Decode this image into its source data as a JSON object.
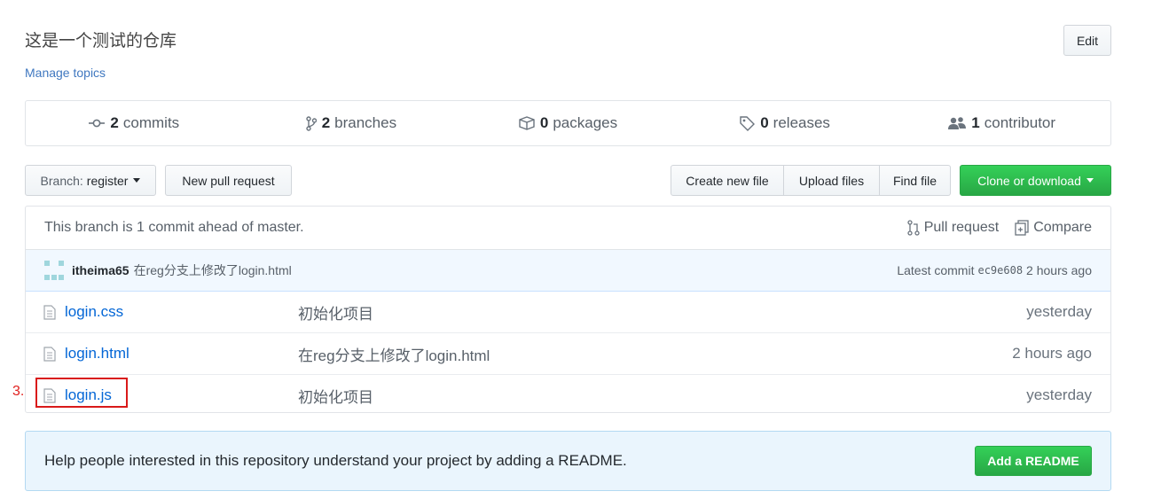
{
  "repo": {
    "description": "这是一个测试的仓库",
    "manage_topics": "Manage topics",
    "edit_label": "Edit"
  },
  "numbers": [
    {
      "icon": "commit-icon",
      "count": "2",
      "label": "commits"
    },
    {
      "icon": "branch-icon",
      "count": "2",
      "label": "branches"
    },
    {
      "icon": "package-icon",
      "count": "0",
      "label": "packages"
    },
    {
      "icon": "tag-icon",
      "count": "0",
      "label": "releases"
    },
    {
      "icon": "people-icon",
      "count": "1",
      "label": "contributor"
    }
  ],
  "toolbar": {
    "branch_prefix": "Branch:",
    "branch_name": "register",
    "new_pull_request": "New pull request",
    "create_new_file": "Create new file",
    "upload_files": "Upload files",
    "find_file": "Find file",
    "clone_or_download": "Clone or download"
  },
  "branch_info": {
    "ahead_text": "This branch is 1 commit ahead of master.",
    "pull_request": "Pull request",
    "compare": "Compare"
  },
  "commit": {
    "author": "itheima65",
    "message": "在reg分支上修改了login.html",
    "latest_label": "Latest commit",
    "sha": "ec9e608",
    "age": "2 hours ago"
  },
  "files": [
    {
      "name": "login.css",
      "message": "初始化项目",
      "age": "yesterday"
    },
    {
      "name": "login.html",
      "message": "在reg分支上修改了login.html",
      "age": "2 hours ago"
    },
    {
      "name": "login.js",
      "message": "初始化项目",
      "age": "yesterday"
    }
  ],
  "annotation": {
    "label": "3.",
    "color": "#d91a1a"
  },
  "readme": {
    "text": "Help people interested in this repository understand your project by adding a README.",
    "button": "Add a README"
  },
  "colors": {
    "accent_green": "#28a745",
    "link_blue": "#0366d6",
    "commit_bar": "#f1f8ff",
    "readme_bg": "#eaf5fd"
  }
}
